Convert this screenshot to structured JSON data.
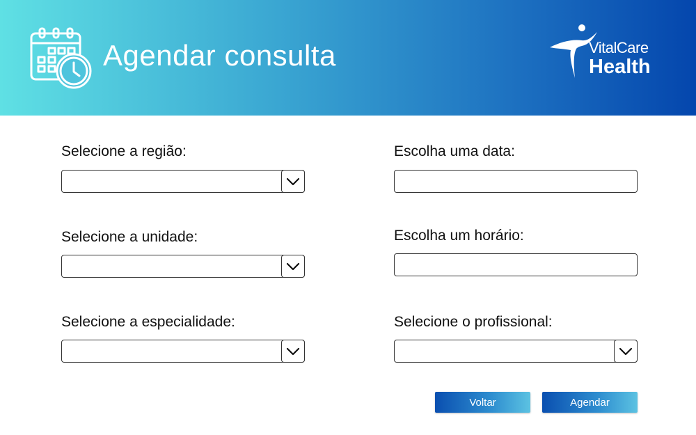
{
  "header": {
    "title": "Agendar consulta",
    "icon": "calendar-clock-icon",
    "gradient_colors": [
      "#5fe0e4",
      "#0446ad"
    ]
  },
  "brand": {
    "logo_icon": "running-figure-logo-icon",
    "name_top": "VitalCare",
    "name_bottom": "Health"
  },
  "form": {
    "regiao": {
      "label": "Selecione a região:",
      "value": ""
    },
    "unidade": {
      "label": "Selecione a unidade:",
      "value": ""
    },
    "especialidade": {
      "label": "Selecione a especialidade:",
      "value": ""
    },
    "data": {
      "label": "Escolha uma data:",
      "value": ""
    },
    "horario": {
      "label": "Escolha um horário:",
      "value": ""
    },
    "profissional": {
      "label": "Selecione o profissional:",
      "value": ""
    }
  },
  "actions": {
    "back_label": "Voltar",
    "submit_label": "Agendar",
    "button_color": "#0a4fb0"
  }
}
